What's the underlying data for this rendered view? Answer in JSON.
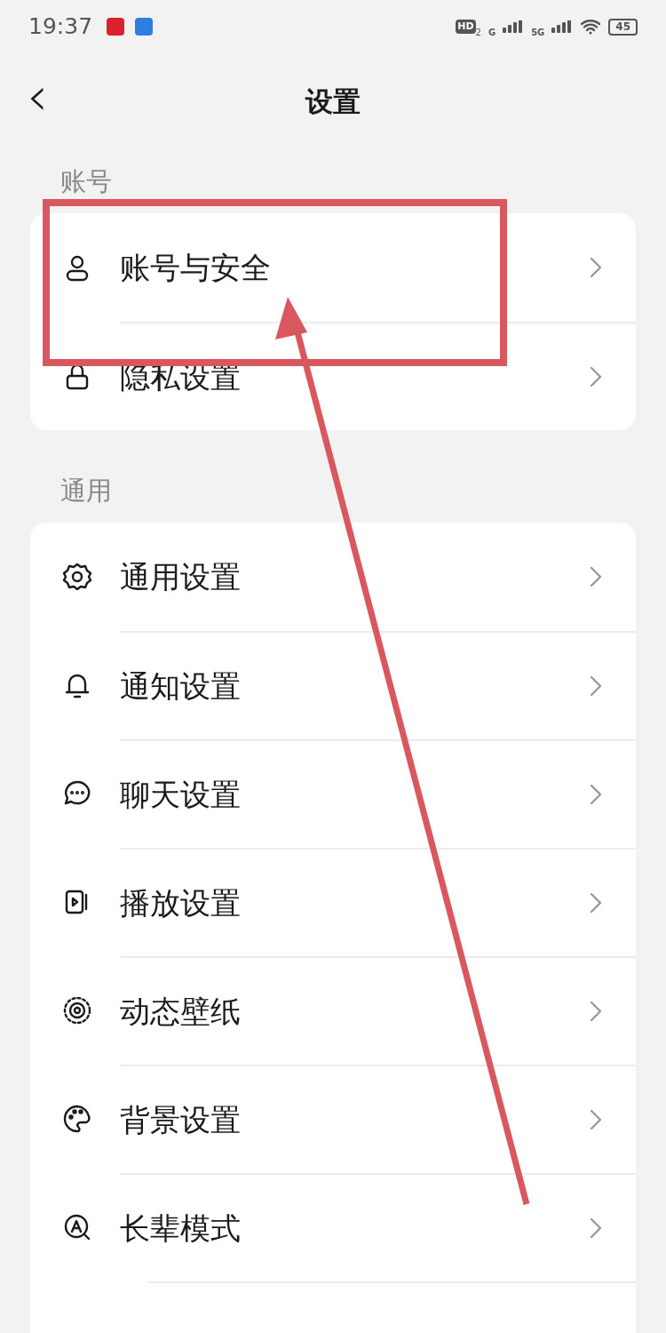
{
  "status_bar": {
    "time": "19:37",
    "hd": "HD",
    "hd_sub": "2",
    "net1": "G",
    "net2": "5G",
    "battery": "45"
  },
  "header": {
    "back": "‹",
    "title": "设置"
  },
  "sections": [
    {
      "label": "账号",
      "items": [
        {
          "label": "账号与安全"
        },
        {
          "label": "隐私设置"
        }
      ]
    },
    {
      "label": "通用",
      "items": [
        {
          "label": "通用设置"
        },
        {
          "label": "通知设置"
        },
        {
          "label": "聊天设置"
        },
        {
          "label": "播放设置"
        },
        {
          "label": "动态壁纸"
        },
        {
          "label": "背景设置"
        },
        {
          "label": "长辈模式"
        }
      ]
    }
  ]
}
